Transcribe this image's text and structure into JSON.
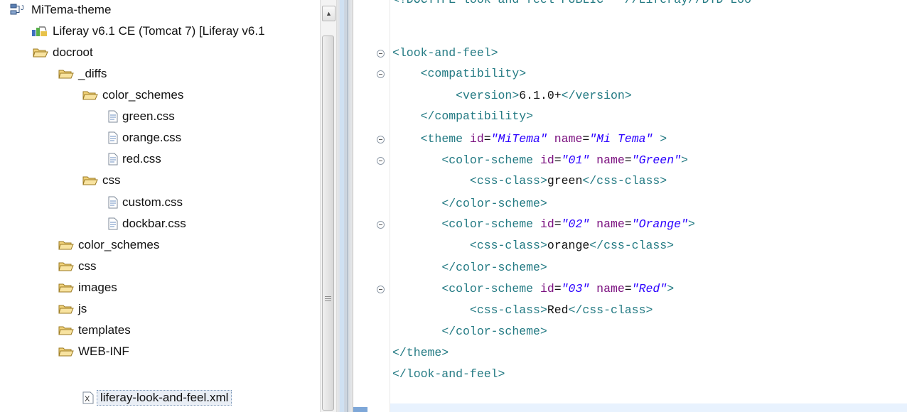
{
  "tree": {
    "items": [
      {
        "label": "MiTema-theme",
        "icon": "project-icon"
      },
      {
        "label": "Liferay v6.1 CE (Tomcat 7) [Liferay v6.1",
        "icon": "server-runtime-icon"
      },
      {
        "label": "docroot",
        "icon": "folder-icon"
      },
      {
        "label": "_diffs",
        "icon": "folder-icon"
      },
      {
        "label": "color_schemes",
        "icon": "folder-icon"
      },
      {
        "label": "green.css",
        "icon": "file-icon"
      },
      {
        "label": "orange.css",
        "icon": "file-icon"
      },
      {
        "label": "red.css",
        "icon": "file-icon"
      },
      {
        "label": "css",
        "icon": "folder-icon"
      },
      {
        "label": "custom.css",
        "icon": "file-icon"
      },
      {
        "label": "dockbar.css",
        "icon": "file-icon"
      },
      {
        "label": "color_schemes",
        "icon": "folder-icon"
      },
      {
        "label": "css",
        "icon": "folder-icon"
      },
      {
        "label": "images",
        "icon": "folder-icon"
      },
      {
        "label": "js",
        "icon": "folder-icon"
      },
      {
        "label": "templates",
        "icon": "folder-icon"
      },
      {
        "label": "WEB-INF",
        "icon": "folder-icon"
      },
      {
        "label": "liferay-look-and-feel.xml",
        "icon": "xml-file-icon"
      }
    ]
  },
  "editor": {
    "lines": [
      {
        "fold": false,
        "tokens": [
          {
            "t": "tag",
            "s": "<!DOCTYPE look-and-feel PUBLIC \"-//Liferay//DTD Loo"
          }
        ]
      },
      {
        "fold": true,
        "tokens": [
          {
            "t": "tag",
            "s": "<look-and-feel>"
          }
        ]
      },
      {
        "fold": true,
        "tokens": [
          {
            "t": "txt",
            "s": "    "
          },
          {
            "t": "tag",
            "s": "<compatibility>"
          }
        ]
      },
      {
        "fold": false,
        "tokens": [
          {
            "t": "txt",
            "s": "         "
          },
          {
            "t": "tag",
            "s": "<version>"
          },
          {
            "t": "txt",
            "s": "6.1.0+"
          },
          {
            "t": "tag",
            "s": "</version>"
          }
        ]
      },
      {
        "fold": false,
        "tokens": [
          {
            "t": "txt",
            "s": "    "
          },
          {
            "t": "tag",
            "s": "</compatibility>"
          }
        ]
      },
      {
        "fold": true,
        "tokens": [
          {
            "t": "txt",
            "s": "    "
          },
          {
            "t": "tag",
            "s": "<theme "
          },
          {
            "t": "attr",
            "s": "id"
          },
          {
            "t": "txt",
            "s": "="
          },
          {
            "t": "val",
            "s": "\"MiTema\""
          },
          {
            "t": "txt",
            "s": " "
          },
          {
            "t": "attr",
            "s": "name"
          },
          {
            "t": "txt",
            "s": "="
          },
          {
            "t": "val",
            "s": "\"Mi Tema\""
          },
          {
            "t": "tag",
            "s": " >"
          }
        ]
      },
      {
        "fold": true,
        "tokens": [
          {
            "t": "txt",
            "s": "       "
          },
          {
            "t": "tag",
            "s": "<color-scheme "
          },
          {
            "t": "attr",
            "s": "id"
          },
          {
            "t": "txt",
            "s": "="
          },
          {
            "t": "val",
            "s": "\"01\""
          },
          {
            "t": "txt",
            "s": " "
          },
          {
            "t": "attr",
            "s": "name"
          },
          {
            "t": "txt",
            "s": "="
          },
          {
            "t": "val",
            "s": "\"Green\""
          },
          {
            "t": "tag",
            "s": ">"
          }
        ]
      },
      {
        "fold": false,
        "tokens": [
          {
            "t": "txt",
            "s": "           "
          },
          {
            "t": "tag",
            "s": "<css-class>"
          },
          {
            "t": "txt",
            "s": "green"
          },
          {
            "t": "tag",
            "s": "</css-class>"
          }
        ]
      },
      {
        "fold": false,
        "tokens": [
          {
            "t": "txt",
            "s": "       "
          },
          {
            "t": "tag",
            "s": "</color-scheme>"
          }
        ]
      },
      {
        "fold": true,
        "tokens": [
          {
            "t": "txt",
            "s": "       "
          },
          {
            "t": "tag",
            "s": "<color-scheme "
          },
          {
            "t": "attr",
            "s": "id"
          },
          {
            "t": "txt",
            "s": "="
          },
          {
            "t": "val",
            "s": "\"02\""
          },
          {
            "t": "txt",
            "s": " "
          },
          {
            "t": "attr",
            "s": "name"
          },
          {
            "t": "txt",
            "s": "="
          },
          {
            "t": "val",
            "s": "\"Orange\""
          },
          {
            "t": "tag",
            "s": ">"
          }
        ]
      },
      {
        "fold": false,
        "tokens": [
          {
            "t": "txt",
            "s": "           "
          },
          {
            "t": "tag",
            "s": "<css-class>"
          },
          {
            "t": "txt",
            "s": "orange"
          },
          {
            "t": "tag",
            "s": "</css-class>"
          }
        ]
      },
      {
        "fold": false,
        "tokens": [
          {
            "t": "txt",
            "s": "       "
          },
          {
            "t": "tag",
            "s": "</color-scheme>"
          }
        ]
      },
      {
        "fold": true,
        "tokens": [
          {
            "t": "txt",
            "s": "       "
          },
          {
            "t": "tag",
            "s": "<color-scheme "
          },
          {
            "t": "attr",
            "s": "id"
          },
          {
            "t": "txt",
            "s": "="
          },
          {
            "t": "val",
            "s": "\"03\""
          },
          {
            "t": "txt",
            "s": " "
          },
          {
            "t": "attr",
            "s": "name"
          },
          {
            "t": "txt",
            "s": "="
          },
          {
            "t": "val",
            "s": "\"Red\""
          },
          {
            "t": "tag",
            "s": ">"
          }
        ]
      },
      {
        "fold": false,
        "tokens": [
          {
            "t": "txt",
            "s": "           "
          },
          {
            "t": "tag",
            "s": "<css-class>"
          },
          {
            "t": "txt",
            "s": "Red"
          },
          {
            "t": "tag",
            "s": "</css-class>"
          }
        ]
      },
      {
        "fold": false,
        "tokens": [
          {
            "t": "txt",
            "s": "       "
          },
          {
            "t": "tag",
            "s": "</color-scheme>"
          }
        ]
      },
      {
        "fold": false,
        "tokens": [
          {
            "t": "tag",
            "s": "</theme>"
          }
        ]
      },
      {
        "fold": false,
        "tokens": [
          {
            "t": "tag",
            "s": "</look-and-feel>"
          }
        ]
      }
    ]
  },
  "colors": {
    "tag": "#237a83",
    "attribute": "#7a0f7f",
    "value": "#2a00ff",
    "text": "#111111",
    "folder": "#e9c25a",
    "current_line": "#e8f2fe"
  }
}
